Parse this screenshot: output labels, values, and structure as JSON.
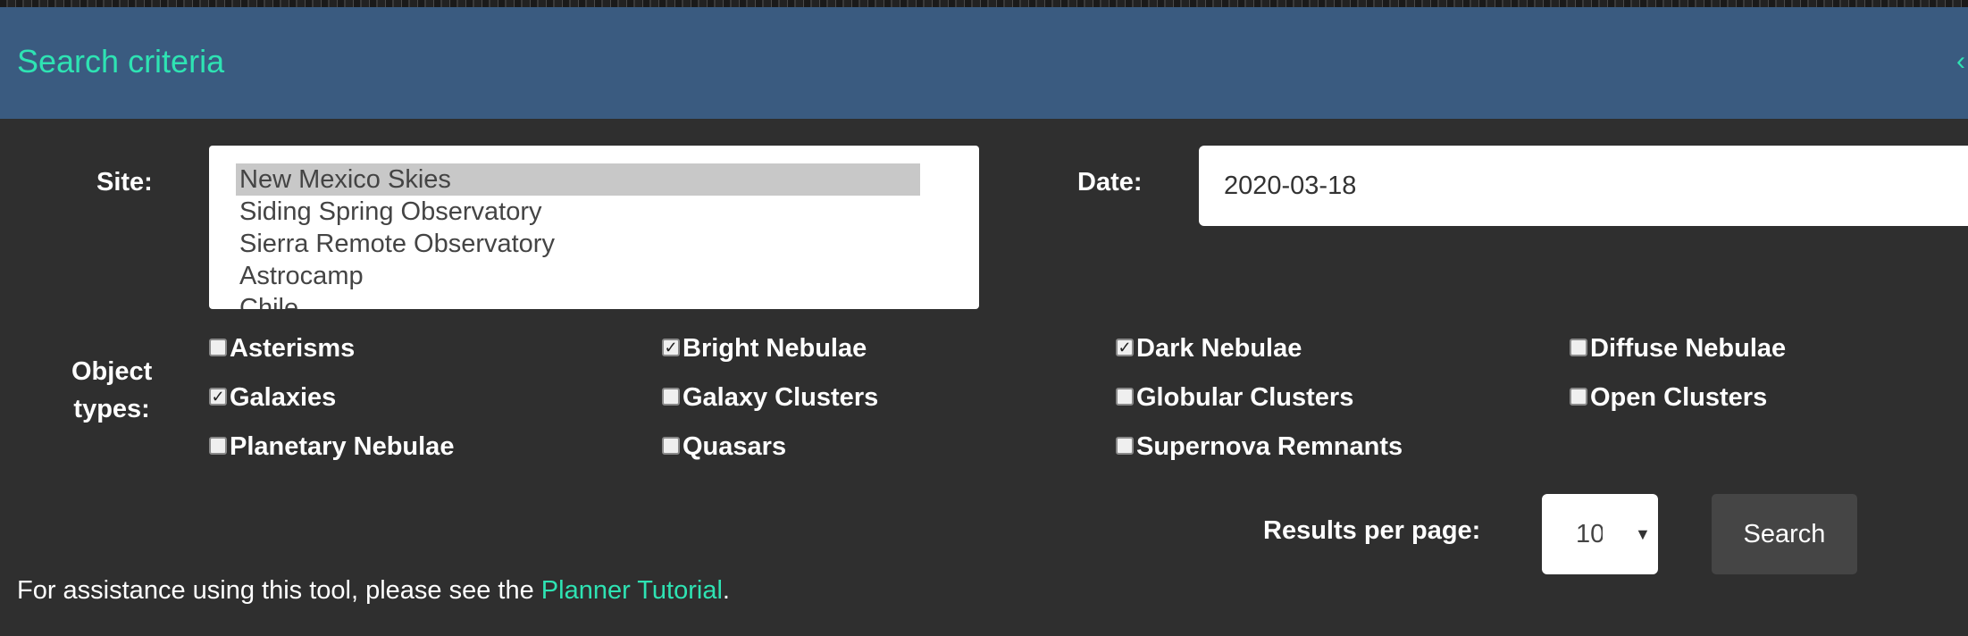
{
  "header": {
    "title": "Search criteria",
    "chevron": "‹"
  },
  "site": {
    "label": "Site:",
    "options": [
      {
        "label": "New Mexico Skies",
        "selected": true
      },
      {
        "label": "Siding Spring Observatory",
        "selected": false
      },
      {
        "label": "Sierra Remote Observatory",
        "selected": false
      },
      {
        "label": "Astrocamp",
        "selected": false
      },
      {
        "label": "Chile",
        "selected": false
      }
    ]
  },
  "date": {
    "label": "Date:",
    "value": "2020-03-18"
  },
  "object_types": {
    "label_line1": "Object",
    "label_line2": "types:",
    "items": [
      {
        "label": "Asterisms",
        "checked": false
      },
      {
        "label": "Bright Nebulae",
        "checked": true
      },
      {
        "label": "Dark Nebulae",
        "checked": true
      },
      {
        "label": "Diffuse Nebulae",
        "checked": false
      },
      {
        "label": "Galaxies",
        "checked": true
      },
      {
        "label": "Galaxy Clusters",
        "checked": false
      },
      {
        "label": "Globular Clusters",
        "checked": false
      },
      {
        "label": "Open Clusters",
        "checked": false
      },
      {
        "label": "Planetary Nebulae",
        "checked": false
      },
      {
        "label": "Quasars",
        "checked": false
      },
      {
        "label": "Supernova Remnants",
        "checked": false
      }
    ]
  },
  "results": {
    "label": "Results per page:",
    "value": "10"
  },
  "search_button": {
    "label": "Search"
  },
  "footer": {
    "prefix": "For assistance using this tool, please see the ",
    "link": "Planner Tutorial",
    "suffix": "."
  },
  "colors": {
    "header_bg": "#3a5b80",
    "accent": "#2ee3b3",
    "body_bg": "#2f2f2f"
  }
}
